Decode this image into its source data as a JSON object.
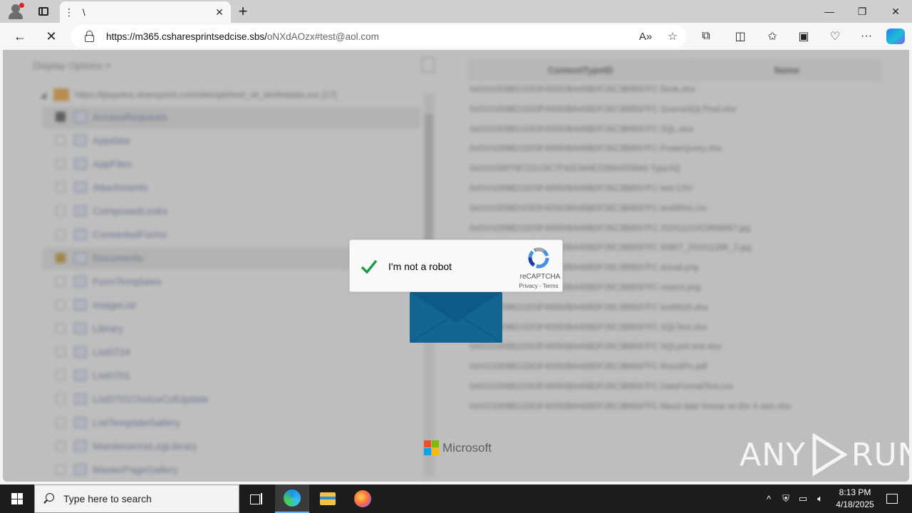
{
  "browser": {
    "tab_title": "\\",
    "tab_menu": "⋮",
    "tab_close": "✕",
    "new_tab": "+",
    "url_host": "https://m365.csharesprintsedcise.sbs/",
    "url_path": "oNXdAOzx#test@aol.com",
    "win_min": "—",
    "win_max": "❐",
    "win_close": "✕",
    "back": "←",
    "stop": "✕",
    "icons": [
      "read-aloud-icon",
      "favorite-star-icon",
      "extensions-icon",
      "split-screen-icon",
      "favorites-icon",
      "collections-icon",
      "browser-essentials-icon",
      "more-icon",
      "copilot-icon"
    ],
    "read_aloud": "A»",
    "star": "☆",
    "extensions": "⧉",
    "split": "◫",
    "favorites": "✩",
    "collections": "▣",
    "essentials": "♡",
    "more": "···"
  },
  "page_bg": {
    "display_options": "Display Options  ˅",
    "site_url": "https://ljaspotus.sharepoint.com/sites/pb/test/_vti_bin/listdata.svc [17]",
    "tree_items": [
      {
        "label": "AccessRequests",
        "state": "partial"
      },
      {
        "label": "Appdata",
        "state": "off"
      },
      {
        "label": "AppFiles",
        "state": "off"
      },
      {
        "label": "Attachments",
        "state": "off"
      },
      {
        "label": "ComposedLooks",
        "state": "off"
      },
      {
        "label": "ConvertedForms",
        "state": "off"
      },
      {
        "label": "Documents",
        "state": "checked"
      },
      {
        "label": "FormTemplates",
        "state": "off"
      },
      {
        "label": "ImageList",
        "state": "off"
      },
      {
        "label": "Library",
        "state": "off"
      },
      {
        "label": "List0724",
        "state": "off"
      },
      {
        "label": "List0701",
        "state": "off"
      },
      {
        "label": "List0701ChoiceColUpdate",
        "state": "off"
      },
      {
        "label": "ListTemplateGallery",
        "state": "off"
      },
      {
        "label": "MaintenanceLogLibrary",
        "state": "off"
      },
      {
        "label": "MasterPageGallery",
        "state": "off"
      }
    ],
    "grid_headers": [
      "ContentTypeID",
      "Name"
    ],
    "grid_rows": [
      "0x0101009B21D03F40050BA45BDF26C3B8597FC Book.xlsx",
      "0x0101009B21D03F40050BA45BDF26C3B8597FC SourceSQLProd.xlsx",
      "0x0101009B21D03F40050BA45BDF26C3B8597FC SQL.xlsx",
      "0x0101009B21D03F40050BA45BDF26C3B8597FC PowerQuery.xlsx",
      "0x010100FFB722215C7F4323A6E22B84325940 TypeSQ",
      "0x0101009B21D03F40050BA45BDF26C3B8597FC test.CSV",
      "0x0101009B21D03F40050BA45BDF26C3B8597FC test0804.csv",
      "0x0101009B21D03F40050BA45BDF26C3B8597FC 20241122423858067.jpg",
      "0x0101009B21D03F40050BA45BDF26C3B8597FC 93807_20241128K_2.jpg",
      "0x0101009B21D03F40050BA45BDF26C3B8597FC actual.png",
      "0x0101009B21D03F40050BA45BDF26C3B8597FC expect.png",
      "0x0101009B21D03F40050BA45BDF26C3B8597FC test0616.xlsx",
      "0x0101009B21D03F40050BA45BDF26C3B8597FC SQLTest.xlsx",
      "0x0101009B21D03F40050BA45BDF26C3B8597FC SQLpivt test.xlsx",
      "0x0101009B21D03F40050BA45BDF26C3B8597FC ResultPs.pdf",
      "0x0101009B21D03F40050BA45BDF26C3B8597FC DateFormatTest.csv",
      "0x0101009B21D03F40050BA45BDF26C3B8597FC About date format on the X axis.xlsx"
    ]
  },
  "captcha": {
    "label": "I'm not a robot",
    "brand": "reCAPTCHA",
    "links": "Privacy - Terms"
  },
  "microsoft": {
    "text": "Microsoft",
    "colors": [
      "#f25022",
      "#7fba00",
      "#00a4ef",
      "#ffb900"
    ]
  },
  "watermark": {
    "left": "ANY",
    "right": "RUN"
  },
  "taskbar": {
    "search_placeholder": "Type here to search",
    "time": "8:13 PM",
    "date": "4/18/2025",
    "tray_chevron": "^",
    "accent": "#6db3f2"
  }
}
